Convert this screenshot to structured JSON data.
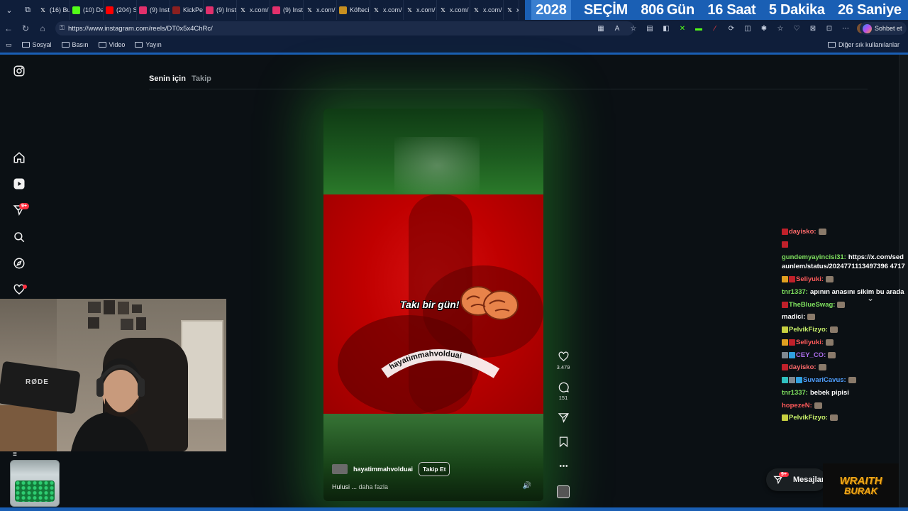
{
  "browser": {
    "tabs": [
      {
        "label": "(16) Bu",
        "icon": "x-icon",
        "color": "#ffffff"
      },
      {
        "label": "(10) Da",
        "icon": "kick-icon",
        "color": "#53fc18"
      },
      {
        "label": "(204) S",
        "icon": "youtube-icon",
        "color": "#ff0000"
      },
      {
        "label": "(9) Inst",
        "icon": "instagram-icon",
        "color": "#e1306c"
      },
      {
        "label": "KickPe",
        "icon": "kick-icon",
        "color": "#8b2020"
      },
      {
        "label": "(9) Inst",
        "icon": "instagram-icon",
        "color": "#e1306c"
      },
      {
        "label": "x.com/",
        "icon": "x-icon",
        "color": "#ffffff"
      },
      {
        "label": "(9) Inst",
        "icon": "instagram-icon",
        "color": "#e1306c"
      },
      {
        "label": "x.com/",
        "icon": "x-icon",
        "color": "#ffffff"
      },
      {
        "label": "Köfteci",
        "icon": "yemek-icon",
        "color": "#c89020"
      },
      {
        "label": "x.com/",
        "icon": "x-icon",
        "color": "#ffffff"
      },
      {
        "label": "x.com/",
        "icon": "x-icon",
        "color": "#ffffff"
      },
      {
        "label": "x.com/",
        "icon": "x-icon",
        "color": "#ffffff"
      },
      {
        "label": "x.com/",
        "icon": "x-icon",
        "color": "#ffffff"
      },
      {
        "label": "x.",
        "icon": "x-icon",
        "color": "#ffffff"
      }
    ],
    "url": "https://www.instagram.com/reels/DT0x5x4ChRc/",
    "chat_button": "Sohbet et",
    "bookmarks": [
      "Sosyal",
      "Basın",
      "Video",
      "Yayın"
    ],
    "other_bookmarks": "Diğer sık kullanılanlar"
  },
  "countdown": {
    "year": "2028",
    "label": "SEÇİM",
    "days": "806",
    "days_unit": "Gün",
    "hours": "16",
    "hours_unit": "Saat",
    "minutes": "5",
    "minutes_unit": "Dakika",
    "seconds": "26",
    "seconds_unit": "Saniye"
  },
  "instagram": {
    "feed_tabs": {
      "for_you": "Senin için",
      "following": "Takip"
    },
    "notifications_badge": "9+",
    "reel": {
      "overlay_text": "Takı bir gün!",
      "curved_text": "hayatimmahvolduai",
      "author": "hayatimmahvolduai",
      "follow_label": "Takip Et",
      "caption": "Hulusi ...",
      "caption_more": "daha fazla",
      "likes": "3.479",
      "comments": "151"
    },
    "messages": {
      "label": "Mesajlar",
      "badge": "9+"
    }
  },
  "stream_chat": [
    {
      "user": "dayisko:",
      "text": "",
      "color": "#ff6b6b",
      "badges": [
        "#c0202a"
      ]
    },
    {
      "user": "",
      "text": "",
      "color": "#ff6b6b",
      "badges": [
        "#c0202a"
      ]
    },
    {
      "user": "gundemyayincisi31:",
      "text": "https://x.com/sedaunlem/status/2024771113497396 4717",
      "color": "#7ee05e",
      "badges": []
    },
    {
      "user": "Seliyuki:",
      "text": "",
      "color": "#ff5a5a",
      "badges": [
        "#e0a020",
        "#c0202a"
      ]
    },
    {
      "user": "tnr1337:",
      "text": "apının anasını sikim bu arada",
      "color": "#7ee05e",
      "badges": []
    },
    {
      "user": "TheBlueSwag:",
      "text": "",
      "color": "#7ee05e",
      "badges": [
        "#c0202a"
      ]
    },
    {
      "user": "madici:",
      "text": "",
      "color": "#ffffff",
      "badges": []
    },
    {
      "user": "PelvikFizyo:",
      "text": "",
      "color": "#c8f06a",
      "badges": [
        "#c8d040"
      ]
    },
    {
      "user": "Seliyuki:",
      "text": "",
      "color": "#ff5a5a",
      "badges": [
        "#e0a020",
        "#c0202a"
      ]
    },
    {
      "user": "CEY_CO:",
      "text": "",
      "color": "#b070f0",
      "badges": [
        "#808890",
        "#30a0e0"
      ]
    },
    {
      "user": "dayisko:",
      "text": "",
      "color": "#ff6b6b",
      "badges": [
        "#c0202a"
      ]
    },
    {
      "user": "SuvariCavus:",
      "text": "",
      "color": "#50a0ff",
      "badges": [
        "#30c0c0",
        "#808890",
        "#30a0e0"
      ]
    },
    {
      "user": "tnr1337:",
      "text": "bebek pipisi",
      "color": "#7ee05e",
      "badges": []
    },
    {
      "user": "hopezeN:",
      "text": "",
      "color": "#ff5a5a",
      "badges": []
    },
    {
      "user": "PelvikFizyo:",
      "text": "",
      "color": "#c8f06a",
      "badges": [
        "#c8d040"
      ]
    }
  ],
  "overlay": {
    "logo_line1": "WRAITH",
    "logo_line2": "BURAK",
    "mic_brand": "RØDE"
  }
}
